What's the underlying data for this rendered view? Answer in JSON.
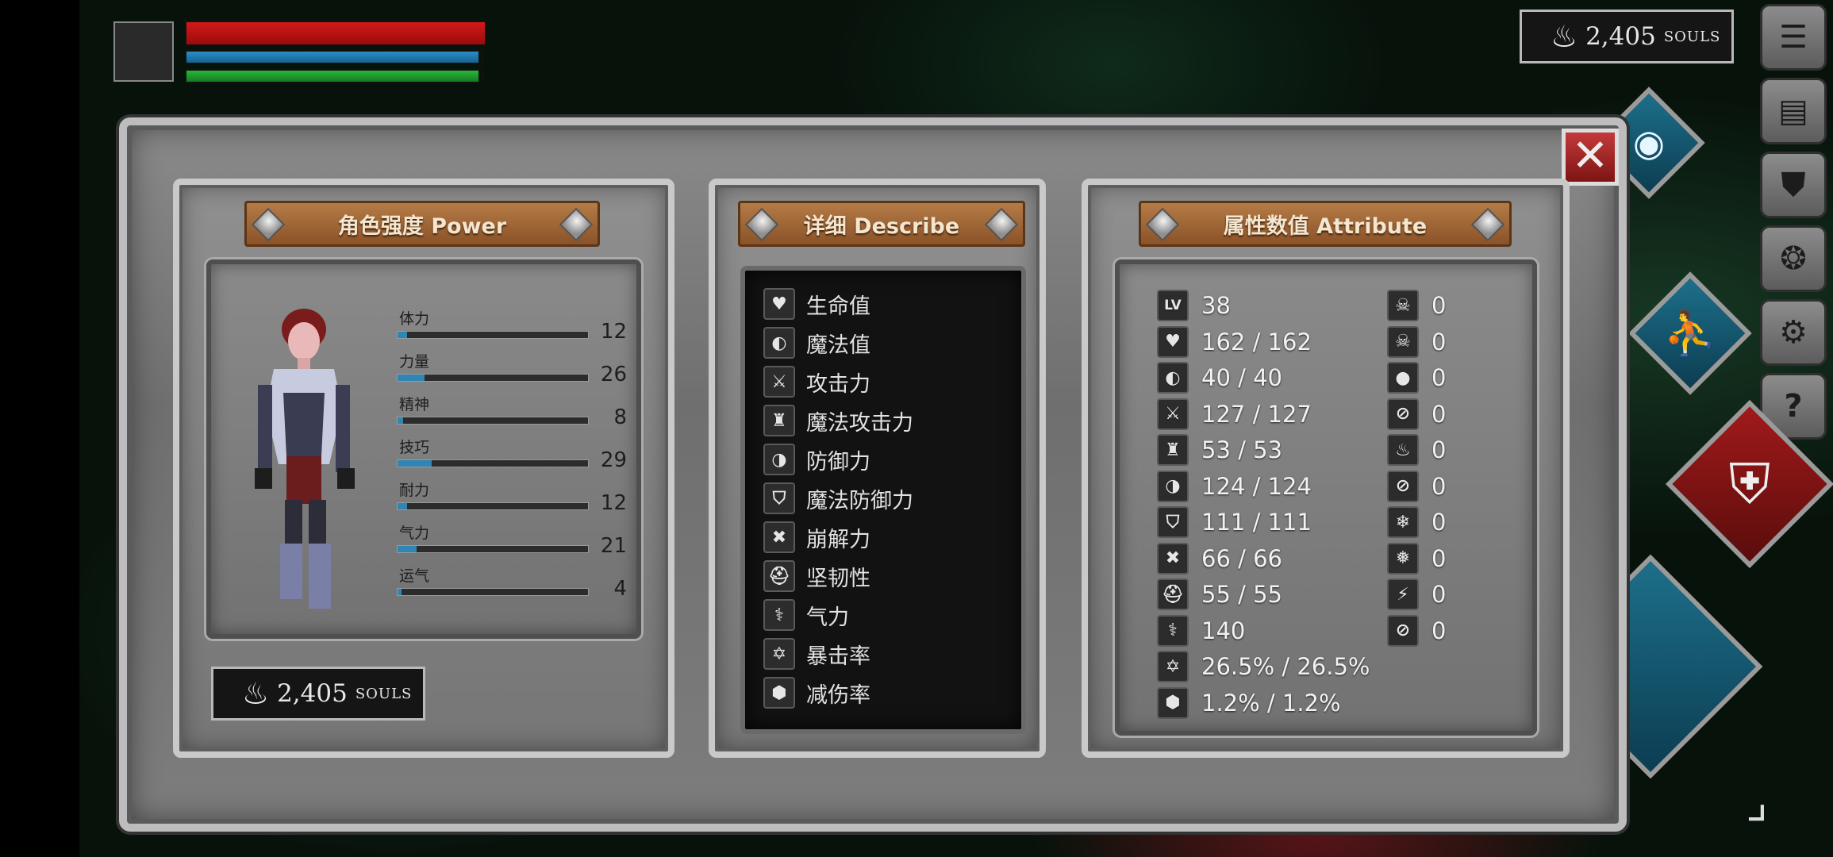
{
  "hud": {
    "souls_value": "2,405",
    "souls_unit": "SOULS",
    "hp_fraction": 1.0,
    "mp_fraction": 0.99,
    "stamina_fraction": 0.99,
    "colors": {
      "hp": "#d41818",
      "mp": "#2a8ec8",
      "stamina": "#28b83a"
    }
  },
  "side_menu": [
    {
      "icon": "list-icon",
      "glyph": "☰"
    },
    {
      "icon": "map-icon",
      "glyph": "▤"
    },
    {
      "icon": "helmet-icon",
      "glyph": "⛊"
    },
    {
      "icon": "medallion-icon",
      "glyph": "❂"
    },
    {
      "icon": "gear-icon",
      "glyph": "⚙"
    },
    {
      "icon": "help-icon",
      "glyph": "?"
    }
  ],
  "panel": {
    "close_glyph": "✕",
    "power": {
      "title": "角色强度 Power",
      "stats": [
        {
          "label": "体力",
          "value": "12",
          "fill": 0.05
        },
        {
          "label": "力量",
          "value": "26",
          "fill": 0.14
        },
        {
          "label": "精神",
          "value": "8",
          "fill": 0.03
        },
        {
          "label": "技巧",
          "value": "29",
          "fill": 0.18
        },
        {
          "label": "耐力",
          "value": "12",
          "fill": 0.05
        },
        {
          "label": "气力",
          "value": "21",
          "fill": 0.1
        },
        {
          "label": "运气",
          "value": "4",
          "fill": 0.02
        }
      ],
      "souls_value": "2,405",
      "souls_unit": "SOULS"
    },
    "describe": {
      "title": "详细 Describe",
      "items": [
        {
          "icon": "heart-icon",
          "glyph": "♥",
          "label": "生命值"
        },
        {
          "icon": "head-icon",
          "glyph": "◐",
          "label": "魔法值"
        },
        {
          "icon": "sword-icon",
          "glyph": "⚔",
          "label": "攻击力"
        },
        {
          "icon": "castle-icon",
          "glyph": "♜",
          "label": "魔法攻击力"
        },
        {
          "icon": "shield-icon",
          "glyph": "◑",
          "label": "防御力"
        },
        {
          "icon": "magic-shield-icon",
          "glyph": "⛉",
          "label": "魔法防御力"
        },
        {
          "icon": "break-icon",
          "glyph": "✖",
          "label": "崩解力"
        },
        {
          "icon": "helmet-icon",
          "glyph": "⛑",
          "label": "坚韧性"
        },
        {
          "icon": "lungs-icon",
          "glyph": "⚕",
          "label": "气力"
        },
        {
          "icon": "star-icon",
          "glyph": "✡",
          "label": "暴击率"
        },
        {
          "icon": "badge-icon",
          "glyph": "⬢",
          "label": "减伤率"
        }
      ]
    },
    "attribute": {
      "title": "属性数值 Attribute",
      "left_col": [
        {
          "icon": "level-icon",
          "glyph": "LV",
          "value": "38"
        },
        {
          "icon": "heart-icon",
          "glyph": "♥",
          "value": "162 / 162"
        },
        {
          "icon": "head-icon",
          "glyph": "◐",
          "value": "40 / 40"
        },
        {
          "icon": "sword-icon",
          "glyph": "⚔",
          "value": "127 / 127"
        },
        {
          "icon": "castle-icon",
          "glyph": "♜",
          "value": "53 / 53"
        },
        {
          "icon": "shield-icon",
          "glyph": "◑",
          "value": "124 / 124"
        },
        {
          "icon": "magic-shield-icon",
          "glyph": "⛉",
          "value": "111 / 111"
        },
        {
          "icon": "break-icon",
          "glyph": "✖",
          "value": "66 / 66"
        },
        {
          "icon": "helmet-icon",
          "glyph": "⛑",
          "value": "55 / 55"
        },
        {
          "icon": "lungs-icon",
          "glyph": "⚕",
          "value": "140"
        },
        {
          "icon": "star-icon",
          "glyph": "✡",
          "value": "26.5% / 26.5%"
        },
        {
          "icon": "badge-icon",
          "glyph": "⬢",
          "value": "1.2% / 1.2%"
        }
      ],
      "right_col": [
        {
          "icon": "skull-icon",
          "glyph": "☠",
          "value": "0"
        },
        {
          "icon": "skull-crossed-icon",
          "glyph": "☠",
          "value": "0"
        },
        {
          "icon": "drop-icon",
          "glyph": "●",
          "value": "0"
        },
        {
          "icon": "drop-crossed-icon",
          "glyph": "⊘",
          "value": "0"
        },
        {
          "icon": "fire-icon",
          "glyph": "♨",
          "value": "0"
        },
        {
          "icon": "fire-crossed-icon",
          "glyph": "⊘",
          "value": "0"
        },
        {
          "icon": "snowflake-icon",
          "glyph": "❄",
          "value": "0"
        },
        {
          "icon": "snowflake-crossed-icon",
          "glyph": "❅",
          "value": "0"
        },
        {
          "icon": "lightning-icon",
          "glyph": "⚡",
          "value": "0"
        },
        {
          "icon": "lightning-crossed-icon",
          "glyph": "⊘",
          "value": "0"
        }
      ]
    }
  }
}
